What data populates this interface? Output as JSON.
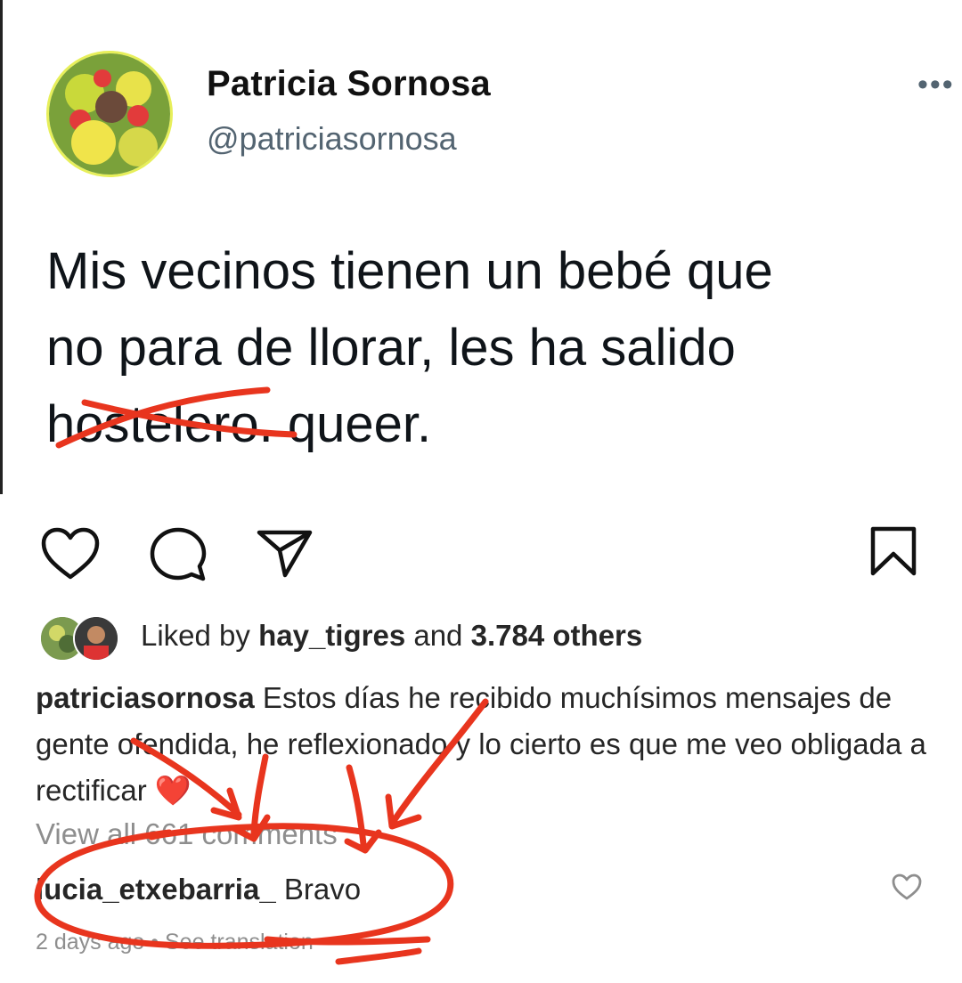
{
  "tweet": {
    "name": "Patricia Sornosa",
    "handle": "@patriciasornosa",
    "more_label": "•••",
    "line1": "Mis vecinos tienen un bebé que",
    "line2": "no para de llorar, les ha salido",
    "struck_word": "hostelero",
    "line3_rest": ".  queer."
  },
  "post": {
    "likes_prefix": "Liked by ",
    "likes_user": "hay_tigres",
    "likes_middle": " and ",
    "likes_count": "3.784 others",
    "caption_user": "patriciasornosa",
    "caption_text": " Estos días he recibido muchísimos mensajes de gente ofendida, he reflexionado y lo cierto es que me veo obligada a rectificar ❤️",
    "view_all": "View all 661 comments",
    "comment_user": "lucia_etxebarria_",
    "comment_text": " Bravo",
    "comment_time": "2 days ago",
    "comment_sep": " • ",
    "see_translation": "See translation"
  },
  "colors": {
    "annotation_red": "#e8351e",
    "handle_gray": "#536471",
    "meta_gray": "#8e8e8e"
  },
  "icons": [
    "heart-icon",
    "comment-icon",
    "share-icon",
    "bookmark-icon",
    "more-icon",
    "small-heart-icon"
  ]
}
